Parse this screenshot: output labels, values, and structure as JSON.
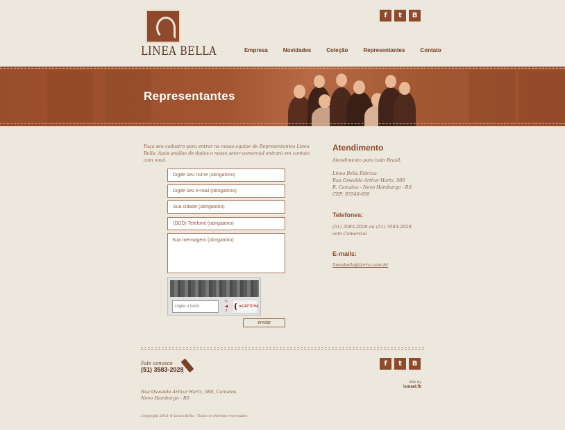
{
  "brand": {
    "logo_text": "LINEA BELLA"
  },
  "social": [
    {
      "icon": "facebook-icon",
      "glyph": "f"
    },
    {
      "icon": "twitter-icon",
      "glyph": "t"
    },
    {
      "icon": "blogger-icon",
      "glyph": "B"
    }
  ],
  "nav": {
    "items": [
      {
        "label": "Empresa"
      },
      {
        "label": "Novidades"
      },
      {
        "label": "Coleção"
      },
      {
        "label": "Representantes"
      },
      {
        "label": "Contato"
      }
    ]
  },
  "banner": {
    "title": "Representantes"
  },
  "form": {
    "intro": "Faça seu cadastro para entrar na nossa equipe de Representantes Linea Bella. Após análise de dados o nosso setor comercial entrará em contato com você.",
    "name_placeholder": "Digite seu nome (obrigatório)",
    "email_placeholder": "Digite seu e-mail (obrigatório)",
    "city_placeholder": "Sua cidade (obrigatório)",
    "phone_placeholder": "(DDD) Telefone (obrigatório)",
    "message_placeholder": "Sua mensagem (obrigatório)",
    "captcha_placeholder": "Digite o texto",
    "captcha_brand": "reCAPTCHA",
    "submit_label": "enviar"
  },
  "sidebar": {
    "heading": "Atendimento",
    "subheading": "Atendimento para todo Brasil:",
    "address_lines": [
      "Linea Bella Fábrica",
      "Rua Oswaldo Arthur Hartz, 980",
      "B. Canudos - Novo Hamburgo - RS",
      "CEP: 93546-650"
    ],
    "phones_heading": "Telefones:",
    "phones_lines": [
      "(51) 3583-2028 ou (51) 3583-2029",
      "com Comercial"
    ],
    "emails_heading": "E-mails:",
    "email": "lineabella@terra.com.br"
  },
  "footer": {
    "fale_label": "Fale conosco",
    "phone": "(51) 3583-2028",
    "site_by_label": "Site by",
    "site_by_name": "ismael.fb",
    "address_lines": [
      "Rua Oswaldo Arthur Hartz, 980, Canudos",
      "Novo Hamburgo - RS"
    ],
    "copyright": "Copyright 2013 © Linea Bella - Todos os direitos reservados."
  }
}
